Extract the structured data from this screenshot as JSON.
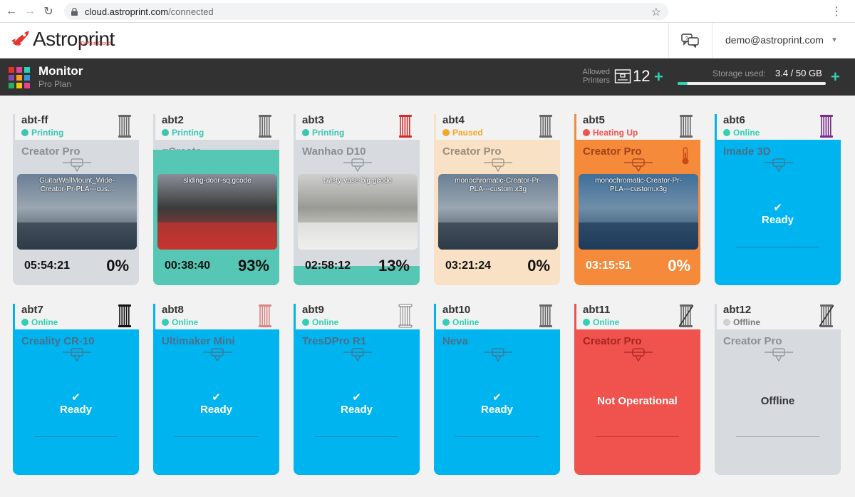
{
  "browser": {
    "url_host": "cloud.astroprint.com",
    "url_path": "/connected"
  },
  "header": {
    "logo_text": "Astroprint",
    "logo_sub": "3D Print Cloud",
    "user_email": "demo@astroprint.com"
  },
  "monitor": {
    "title": "Monitor",
    "plan": "Pro Plan",
    "allowed_label": "Allowed Printers",
    "allowed_count": "12",
    "storage_label": "Storage used:",
    "storage_value": "3.4 / 50 GB",
    "storage_fraction": 0.068,
    "grid_colors": [
      "#e3342f",
      "#e84393",
      "#2fd0b5",
      "#8e44ad",
      "#ff9f1a",
      "#3498db",
      "#27ae60",
      "#f1c40f",
      "#e84393"
    ]
  },
  "colors": {
    "blue": "#00b4f0",
    "grey": "#d7dbe0",
    "teal": "#55c7b4",
    "peach": "#f8e1c4",
    "orange": "#f58b3a",
    "red": "#f0524e",
    "green": "#2fd0b5",
    "pink": "#f28b82"
  },
  "printers": [
    {
      "name": "abt-ff",
      "status": "Printing",
      "status_color": "#3cc6b0",
      "spool": "#666666",
      "spool_style": "plain",
      "model": "Creator Pro",
      "variant": "printing",
      "body": "#d7dbe0",
      "model_color": "#8a8f96",
      "progress": 0,
      "file": "GuitarWallMount_Wide-Creator-Pr-PLA---cus...",
      "time": "05:54:21",
      "pct": "0%",
      "thumb": [
        "#6b7f95",
        "#2d3a47",
        "#9aa6b1"
      ],
      "accent": "#d7dbe0"
    },
    {
      "name": "abt2",
      "status": "Printing",
      "status_color": "#3cc6b0",
      "spool": "#666666",
      "spool_style": "plain",
      "model": "gCreate",
      "variant": "printing",
      "body": "#d7dbe0",
      "model_color": "#8a8f96",
      "progress": 0.93,
      "file": "sliding-door-sq.gcode",
      "time": "00:38:40",
      "pct": "93%",
      "thumb": [
        "#8a8f9a",
        "#c7342f",
        "#3b3b3b"
      ],
      "accent": "#d7dbe0"
    },
    {
      "name": "abt3",
      "status": "Printing",
      "status_color": "#3cc6b0",
      "spool": "#d42c2c",
      "spool_style": "plain",
      "model": "Wanhao D10",
      "variant": "printing",
      "body": "#d7dbe0",
      "model_color": "#8a8f96",
      "progress": 0.13,
      "file": "twisty-vase-big.gcode",
      "time": "02:58:12",
      "pct": "13%",
      "thumb": [
        "#cfcfcf",
        "#f0f0ee",
        "#9a9a94"
      ],
      "accent": "#d7dbe0"
    },
    {
      "name": "abt4",
      "status": "Paused",
      "status_color": "#f5a623",
      "spool": "#666666",
      "spool_style": "plain",
      "model": "Creator Pro",
      "variant": "printing",
      "body": "#f8e1c4",
      "model_color": "#9a8d7d",
      "progress": 0,
      "file": "monochromatic-Creator-Pr-PLA---custom.x3g",
      "time": "03:21:24",
      "pct": "0%",
      "thumb": [
        "#6b7f95",
        "#2d3a47",
        "#9aa6b1"
      ],
      "accent": "#f8e1c4"
    },
    {
      "name": "abt5",
      "status": "Heating Up",
      "status_color": "#f0524e",
      "spool": "#666666",
      "spool_style": "plain",
      "model": "Creator Pro",
      "variant": "heating",
      "body": "#f58b3a",
      "model_color": "#a4401a",
      "progress": 0,
      "file": "monochromatic-Creator-Pr-PLA---custom.x3g",
      "time": "03:15:51",
      "pct": "0%",
      "thumb": [
        "#3f6f9a",
        "#1e3b5a",
        "#6f8fa9"
      ],
      "accent": "#f58b3a"
    },
    {
      "name": "abt6",
      "status": "Online",
      "status_color": "#2fd0b5",
      "spool": "#7b2a8c",
      "spool_style": "plain",
      "model": "Imade 3D",
      "variant": "ready",
      "body": "#00b4f0",
      "model_color": "#4a6f8a",
      "ready": "Ready",
      "accent": "#00b4f0"
    },
    {
      "name": "abt7",
      "status": "Online",
      "status_color": "#2fd0b5",
      "spool": "#111111",
      "spool_style": "plain",
      "model": "Creality CR-10",
      "variant": "ready",
      "body": "#00b4f0",
      "model_color": "#4a6f8a",
      "ready": "Ready",
      "accent": "#00b4f0"
    },
    {
      "name": "abt8",
      "status": "Online",
      "status_color": "#2fd0b5",
      "spool": "#d98585",
      "spool_style": "plain",
      "model": "Ultimaker Mini",
      "variant": "ready",
      "body": "#00b4f0",
      "model_color": "#4a6f8a",
      "ready": "Ready",
      "accent": "#00b4f0"
    },
    {
      "name": "abt9",
      "status": "Online",
      "status_color": "#2fd0b5",
      "spool": "#f5f5f5",
      "spool_style": "plain",
      "model": "TresDPro R1",
      "variant": "ready",
      "body": "#00b4f0",
      "model_color": "#4a6f8a",
      "ready": "Ready",
      "accent": "#00b4f0"
    },
    {
      "name": "abt10",
      "status": "Online",
      "status_color": "#2fd0b5",
      "spool": "#666666",
      "spool_style": "plain",
      "model": "Neva",
      "variant": "ready",
      "body": "#00b4f0",
      "model_color": "#4a6f8a",
      "ready": "Ready",
      "accent": "#00b4f0"
    },
    {
      "name": "abt11",
      "status": "Online",
      "status_color": "#2fd0b5",
      "spool": "#666666",
      "spool_style": "crossed",
      "model": "Creator Pro",
      "variant": "error",
      "body": "#f0524e",
      "model_color": "#a82420",
      "big": "Not Operational",
      "big_color": "#ffffff",
      "accent": "#f0524e"
    },
    {
      "name": "abt12",
      "status": "Offline",
      "status_color": "#d0d0d0",
      "status_text_color": "#777777",
      "spool": "#666666",
      "spool_style": "crossed",
      "model": "Creator Pro",
      "variant": "offline",
      "body": "#d7dbe0",
      "model_color": "#8a8f96",
      "big": "Offline",
      "big_color": "#333333",
      "accent": "#d7dbe0"
    }
  ]
}
